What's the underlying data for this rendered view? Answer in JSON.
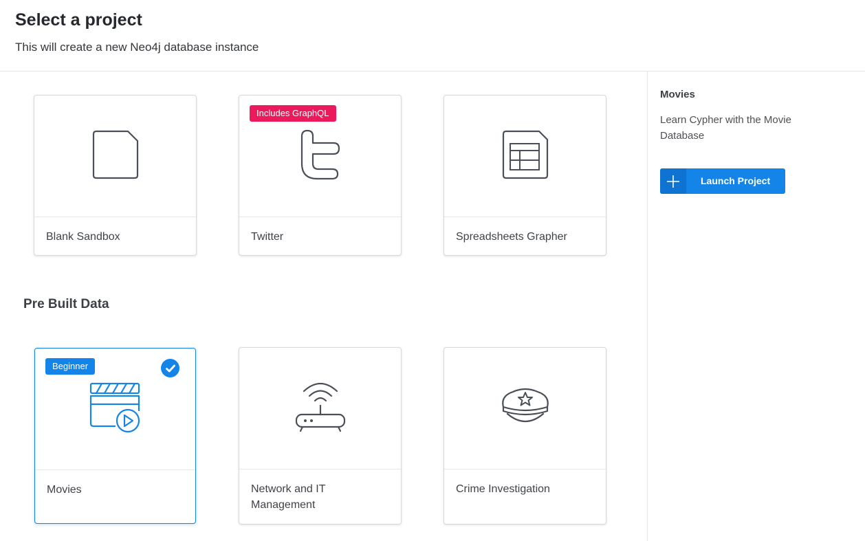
{
  "header": {
    "title": "Select a project",
    "subtitle": "This will create a new Neo4j database instance"
  },
  "projects": [
    {
      "label": "Blank Sandbox",
      "icon": "blank-document-icon"
    },
    {
      "label": "Twitter",
      "icon": "twitter-icon",
      "badge": "Includes GraphQL"
    },
    {
      "label": "Spreadsheets Grapher",
      "icon": "spreadsheet-icon"
    }
  ],
  "prebuilt": {
    "title": "Pre Built Data",
    "items": [
      {
        "label": "Movies",
        "icon": "movie-clapper-icon",
        "badge": "Beginner",
        "selected": true
      },
      {
        "label": "Network and IT Management",
        "icon": "router-icon"
      },
      {
        "label": "Crime Investigation",
        "icon": "police-hat-icon"
      }
    ]
  },
  "side_panel": {
    "title": "Movies",
    "description": "Learn Cypher with the Movie Database",
    "launch_label": "Launch Project"
  },
  "colors": {
    "accent": "#1584e8",
    "badge_pink": "#ea1a5c",
    "icon_gray": "#4a4f57"
  }
}
